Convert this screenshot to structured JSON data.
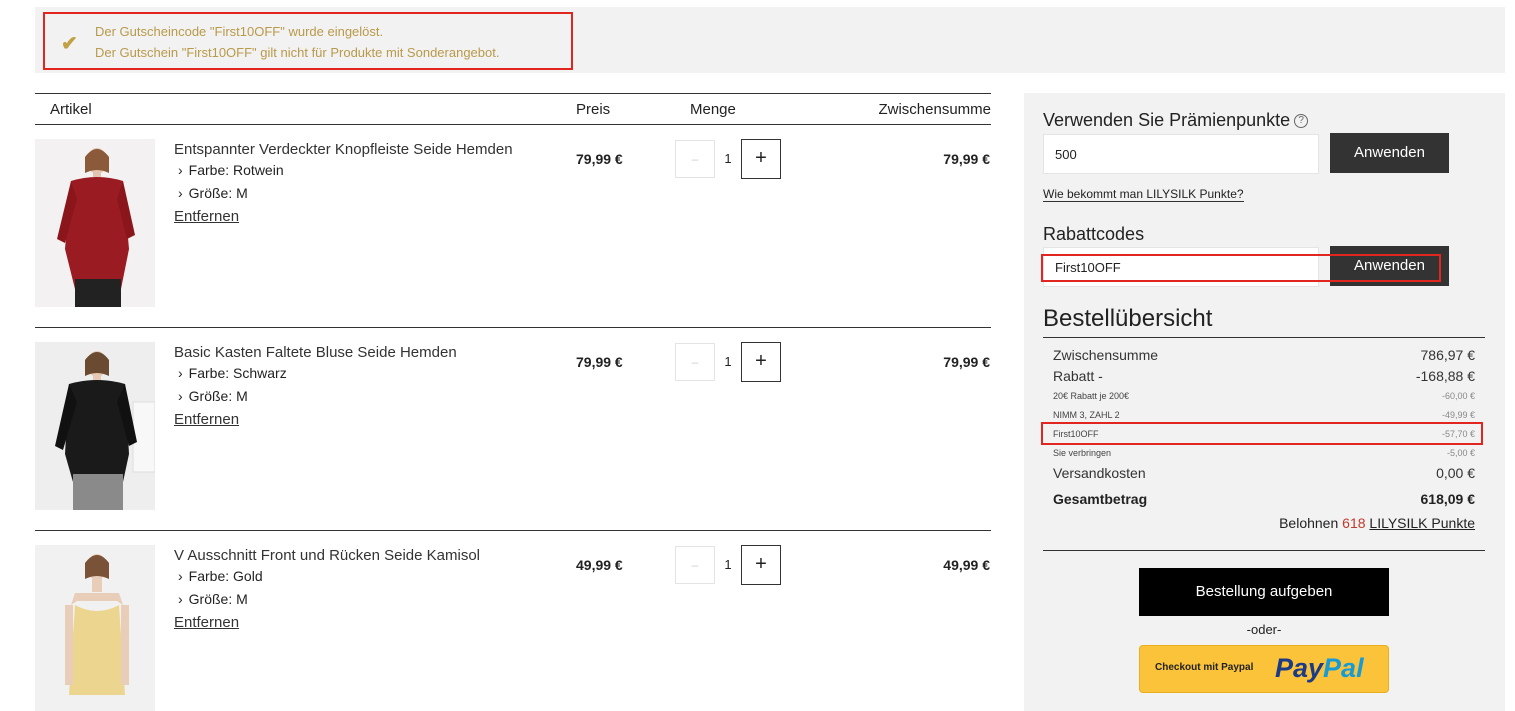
{
  "notice": {
    "line1": "Der Gutscheincode \"First10OFF\" wurde eingelöst.",
    "line2": "Der Gutschein \"First10OFF\" gilt nicht für Produkte mit Sonderangebot."
  },
  "cart": {
    "headers": {
      "item": "Artikel",
      "price": "Preis",
      "qty": "Menge",
      "subtotal": "Zwischensumme"
    },
    "items": [
      {
        "title": "Entspannter Verdeckter Knopfleiste Seide Hemden",
        "color_label": "Farbe:",
        "color": "Rotwein",
        "size_label": "Größe:",
        "size": "M",
        "remove": "Entfernen",
        "price": "79,99 €",
        "qty": "1",
        "subtotal": "79,99 €"
      },
      {
        "title": "Basic Kasten Faltete Bluse Seide Hemden",
        "color_label": "Farbe:",
        "color": "Schwarz",
        "size_label": "Größe:",
        "size": "M",
        "remove": "Entfernen",
        "price": "79,99 €",
        "qty": "1",
        "subtotal": "79,99 €"
      },
      {
        "title": "V Ausschnitt Front und Rücken Seide Kamisol",
        "color_label": "Farbe:",
        "color": "Gold",
        "size_label": "Größe:",
        "size": "M",
        "remove": "Entfernen",
        "price": "49,99 €",
        "qty": "1",
        "subtotal": "49,99 €"
      }
    ]
  },
  "points": {
    "title": "Verwenden Sie Prämienpunkte",
    "value": "500",
    "apply": "Anwenden",
    "howto": "Wie bekommt man LILYSILK Punkte?"
  },
  "coupon": {
    "title": "Rabattcodes",
    "value": "First10OFF",
    "apply": "Anwenden"
  },
  "summary": {
    "title": "Bestellübersicht",
    "subtotal_label": "Zwischensumme",
    "subtotal": "786,97 €",
    "discount_label": "Rabatt -",
    "discount": "-168,88 €",
    "discounts": [
      {
        "label": "20€ Rabatt je 200€",
        "value": "-60,00 €"
      },
      {
        "label": "NIMM 3, ZAHL 2",
        "value": "-49,99 €"
      },
      {
        "label": "First10OFF",
        "value": "-57,70 €"
      },
      {
        "label": "Sie verbringen",
        "value": "-5,00 €"
      }
    ],
    "shipping_label": "Versandkosten",
    "shipping": "0,00 €",
    "total_label": "Gesamtbetrag",
    "total": "618,09 €",
    "reward_prefix": "Belohnen",
    "reward_points": "618",
    "reward_suffix": "LILYSILK Punkte"
  },
  "checkout": {
    "order_button": "Bestellung aufgeben",
    "or": "-oder-",
    "paypal_text": "Checkout mit Paypal",
    "paypal_logo_a": "Pay",
    "paypal_logo_b": "Pal"
  },
  "colors": {
    "accent_red": "#e0261f",
    "notice_text": "#b99a4a",
    "paypal_yellow": "#fbc33a"
  }
}
